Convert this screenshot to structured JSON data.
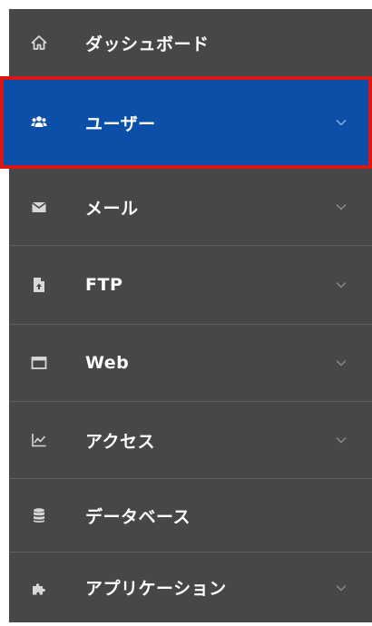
{
  "menu": {
    "items": [
      {
        "label": "ダッシュボード",
        "icon": "home-icon",
        "has_chevron": false,
        "active": false
      },
      {
        "label": "ユーザー",
        "icon": "users-icon",
        "has_chevron": true,
        "active": true
      },
      {
        "label": "メール",
        "icon": "envelope-icon",
        "has_chevron": true,
        "active": false
      },
      {
        "label": "FTP",
        "icon": "file-upload-icon",
        "has_chevron": true,
        "active": false
      },
      {
        "label": "Web",
        "icon": "browser-window-icon",
        "has_chevron": true,
        "active": false
      },
      {
        "label": "アクセス",
        "icon": "line-chart-icon",
        "has_chevron": true,
        "active": false
      },
      {
        "label": "データベース",
        "icon": "database-icon",
        "has_chevron": false,
        "active": false
      },
      {
        "label": "アプリケーション",
        "icon": "puzzle-icon",
        "has_chevron": true,
        "active": false
      }
    ]
  },
  "colors": {
    "menu_background": "#474747",
    "active_background": "#0b4fa8",
    "highlight_border": "#d81616",
    "divider": "#5e5e5e"
  }
}
